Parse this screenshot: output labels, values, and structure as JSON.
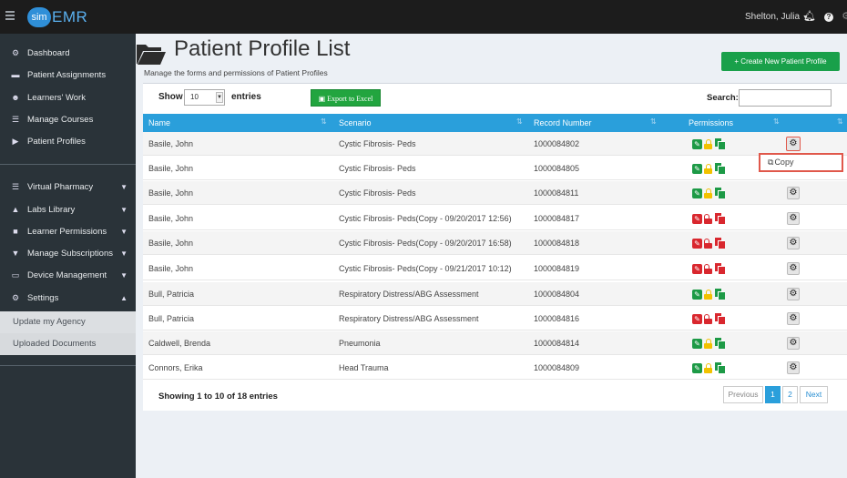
{
  "app": {
    "logo_prefix": "sim",
    "logo_suffix": "EMR"
  },
  "header": {
    "user_name": "Shelton, Julia"
  },
  "sidebar": {
    "items": [
      {
        "label": "Dashboard",
        "icon": "dashboard-icon",
        "glyph": "⚙"
      },
      {
        "label": "Patient Assignments",
        "icon": "bed-icon",
        "glyph": "▬"
      },
      {
        "label": "Learners' Work",
        "icon": "users-icon",
        "glyph": "☻"
      },
      {
        "label": "Manage Courses",
        "icon": "list-icon",
        "glyph": "☰"
      },
      {
        "label": "Patient Profiles",
        "icon": "folder-open-icon",
        "glyph": "▶"
      },
      {
        "label": "Virtual Pharmacy",
        "icon": "medkit-icon",
        "glyph": "☰"
      },
      {
        "label": "Labs Library",
        "icon": "flask-icon",
        "glyph": "▲"
      },
      {
        "label": "Learner Permissions",
        "icon": "lock-icon",
        "glyph": "■"
      },
      {
        "label": "Manage Subscriptions",
        "icon": "cart-icon",
        "glyph": "▼"
      },
      {
        "label": "Device Management",
        "icon": "desktop-icon",
        "glyph": "▭"
      },
      {
        "label": "Settings",
        "icon": "cog-icon",
        "glyph": "⚙"
      }
    ],
    "subitems": [
      "Update my Agency",
      "Uploaded Documents"
    ]
  },
  "page": {
    "title": "Patient Profile List",
    "subtitle": "Manage the forms and permissions of Patient Profiles",
    "create_button": "+ Create New Patient Profile"
  },
  "controls": {
    "show_label": "Show",
    "page_size": "10",
    "entries_label": "entries",
    "export_button": "Export to Excel",
    "search_label": "Search:",
    "search_value": ""
  },
  "table": {
    "headers": [
      "Name",
      "Scenario",
      "Record Number",
      "Permissions"
    ],
    "rows": [
      {
        "name": "Basile, John",
        "scenario": "Cystic Fibrosis- Peds",
        "record": "1000084802",
        "locked": false
      },
      {
        "name": "Basile, John",
        "scenario": "Cystic Fibrosis- Peds",
        "record": "1000084805",
        "locked": false
      },
      {
        "name": "Basile, John",
        "scenario": "Cystic Fibrosis- Peds",
        "record": "1000084811",
        "locked": false
      },
      {
        "name": "Basile, John",
        "scenario": "Cystic Fibrosis- Peds(Copy - 09/20/2017 12:56)",
        "record": "1000084817",
        "locked": true
      },
      {
        "name": "Basile, John",
        "scenario": "Cystic Fibrosis- Peds(Copy - 09/20/2017 16:58)",
        "record": "1000084818",
        "locked": true
      },
      {
        "name": "Basile, John",
        "scenario": "Cystic Fibrosis- Peds(Copy - 09/21/2017 10:12)",
        "record": "1000084819",
        "locked": true
      },
      {
        "name": "Bull, Patricia",
        "scenario": "Respiratory Distress/ABG Assessment",
        "record": "1000084804",
        "locked": false
      },
      {
        "name": "Bull, Patricia",
        "scenario": "Respiratory Distress/ABG Assessment",
        "record": "1000084816",
        "locked": true
      },
      {
        "name": "Caldwell, Brenda",
        "scenario": "Pneumonia",
        "record": "1000084814",
        "locked": false
      },
      {
        "name": "Connors, Erika",
        "scenario": "Head Trauma",
        "record": "1000084809",
        "locked": false
      }
    ]
  },
  "context_menu": {
    "label": "Copy"
  },
  "footer": {
    "showing_text": "Showing 1 to 10 of 18 entries",
    "previous": "Previous",
    "pages": [
      "1",
      "2"
    ],
    "next": "Next"
  },
  "colors": {
    "accent": "#2a9fdb",
    "success": "#1d9a46",
    "danger": "#d9272e",
    "warning": "#f2c200",
    "sidebar": "#2a3339"
  }
}
